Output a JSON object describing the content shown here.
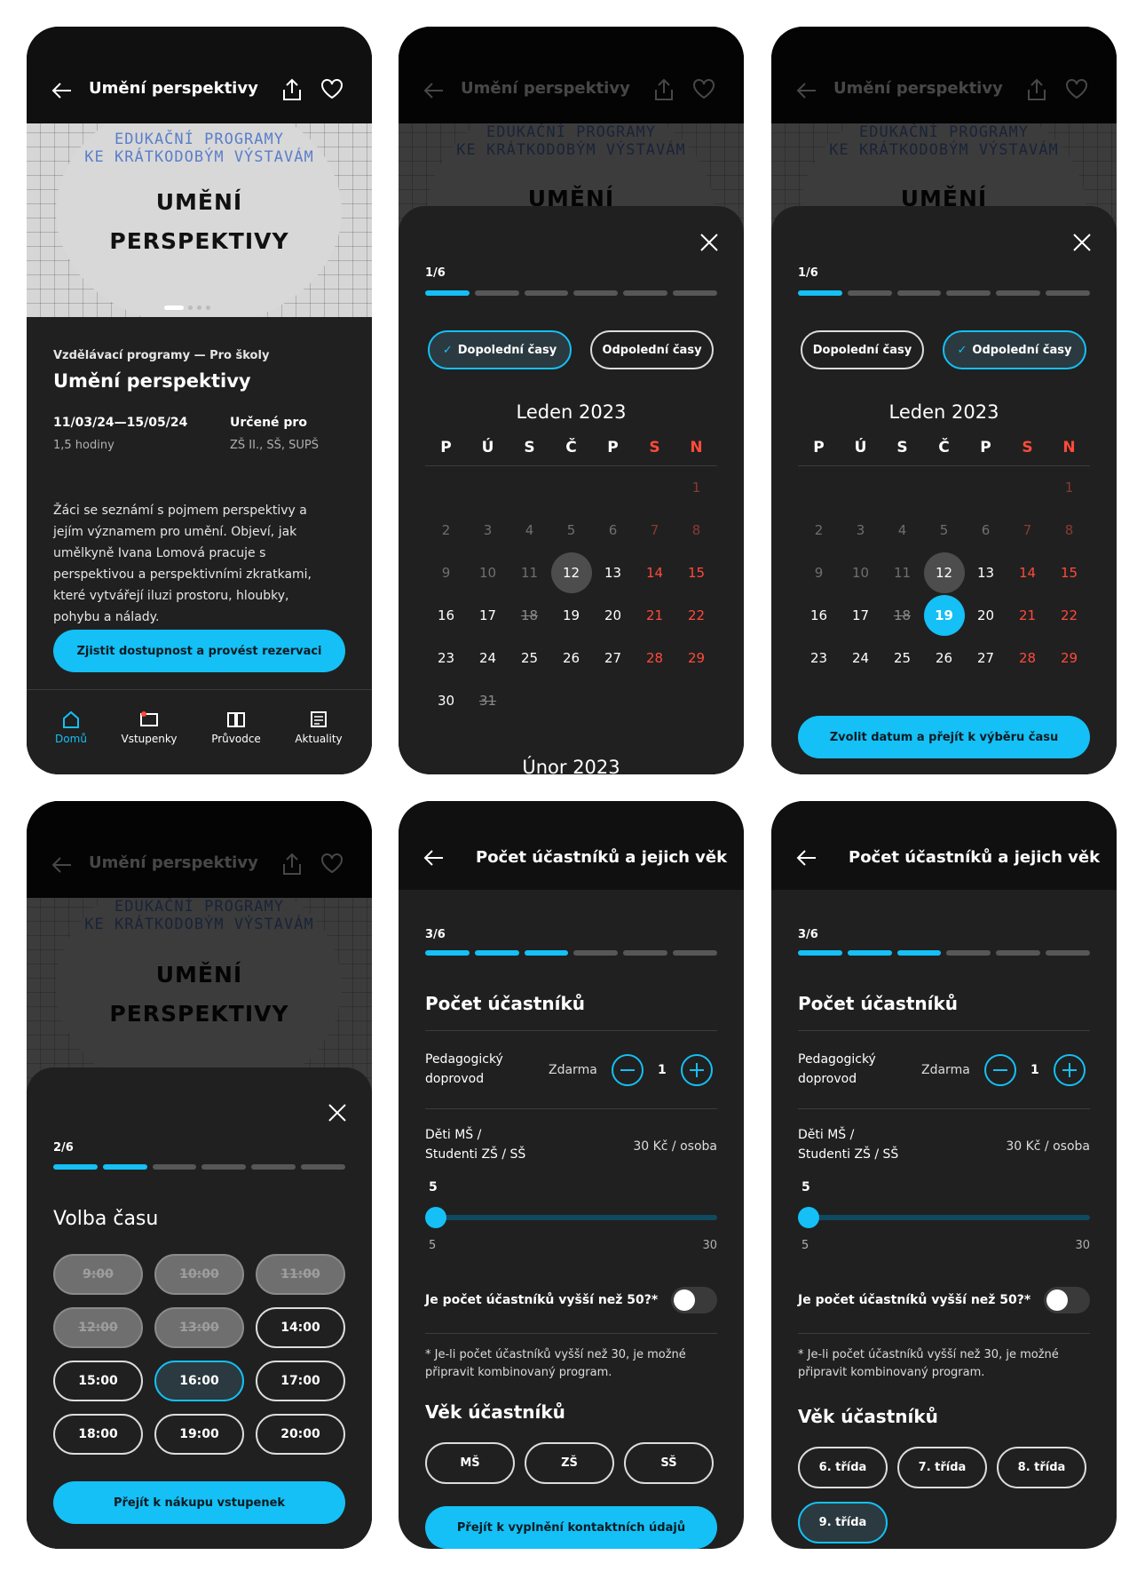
{
  "colors": {
    "accent": "#14c0f5",
    "weekend": "#ff4a3c",
    "sheet": "#202020",
    "background": "#000000"
  },
  "screen1": {
    "title": "Umění perspektivy",
    "hero": {
      "edu_line1": "EDUKAČNÍ PROGRAMY",
      "edu_line2": "KE KRÁTKODOBÝM VÝSTAVÁM",
      "big_line1": "UMĚNÍ",
      "big_line2": "PERSPEKTIVY"
    },
    "category": "Vzdělávací programy — Pro školy",
    "heading": "Umění perspektivy",
    "dates": "11/03/24—15/05/24",
    "duration": "1,5 hodiny",
    "for_label": "Určené pro",
    "for_value": "ZŠ II., SŠ, SUPŠ",
    "description": "Žáci se seznámí s pojmem perspektivy a jejím významem pro umění. Objeví, jak umělkyně Ivana Lomová pracuje s perspektivou a perspektivními zkratkami, které vytvářejí iluzi prostoru, hloubky, pohybu a nálady.",
    "cta": "Zjistit dostupnost a provést rezervaci",
    "tabs": [
      {
        "label": "Domů",
        "icon": "home-icon"
      },
      {
        "label": "Vstupenky",
        "icon": "ticket-icon"
      },
      {
        "label": "Průvodce",
        "icon": "book-icon"
      },
      {
        "label": "Aktuality",
        "icon": "news-icon"
      }
    ]
  },
  "calendar": {
    "step": "1/6",
    "morning": "Dopolední časy",
    "afternoon": "Odpolední časy",
    "month": "Leden 2023",
    "next_month": "Únor 2023",
    "weekdays": [
      "P",
      "Ú",
      "S",
      "Č",
      "P",
      "S",
      "N"
    ],
    "rows": [
      [
        "",
        "",
        "",
        "",
        "",
        "",
        "1"
      ],
      [
        "2",
        "3",
        "4",
        "5",
        "6",
        "7",
        "8"
      ],
      [
        "9",
        "10",
        "11",
        "12",
        "13",
        "14",
        "15"
      ],
      [
        "16",
        "17",
        "18",
        "19",
        "20",
        "21",
        "22"
      ],
      [
        "23",
        "24",
        "25",
        "26",
        "27",
        "28",
        "29"
      ],
      [
        "30",
        "31",
        "",
        "",
        "",
        "",
        ""
      ]
    ],
    "today": "12",
    "selected": "19",
    "confirm": "Zvolit datum a přejít k výběru času"
  },
  "time": {
    "step": "2/6",
    "title": "Volba času",
    "slots": [
      "9:00",
      "10:00",
      "11:00",
      "12:00",
      "13:00",
      "14:00",
      "15:00",
      "16:00",
      "17:00",
      "18:00",
      "19:00",
      "20:00"
    ],
    "disabled": [
      "9:00",
      "10:00",
      "11:00",
      "12:00",
      "13:00"
    ],
    "selected": "16:00",
    "cta": "Přejít k nákupu vstupenek"
  },
  "participants": {
    "title": "Počet účastníků a jejich věk",
    "step": "3/6",
    "section": "Počet účastníků",
    "teacher_line1": "Pedagogický",
    "teacher_line2": "doprovod",
    "teacher_price": "Zdarma",
    "teacher_count": "1",
    "kids_line1": "Děti MŠ /",
    "kids_line2": "Studenti ZŠ / SŠ",
    "kids_price": "30 Kč / osoba",
    "slider_value": "5",
    "slider_min": "5",
    "slider_max": "30",
    "over50": "Je počet účastníků vyšší než 50?*",
    "note": "* Je-li počet účastníků vyšší než 30, je možné připravit kombinovaný program.",
    "age_title": "Věk účastníků",
    "age_options": [
      "MŠ",
      "ZŠ",
      "SŠ"
    ],
    "grade_options": [
      "6. třída",
      "7. třída",
      "8. třída",
      "9. třída"
    ],
    "grade_selected": "9. třída",
    "cta": "Přejít k vyplnění kontaktních údajů"
  }
}
